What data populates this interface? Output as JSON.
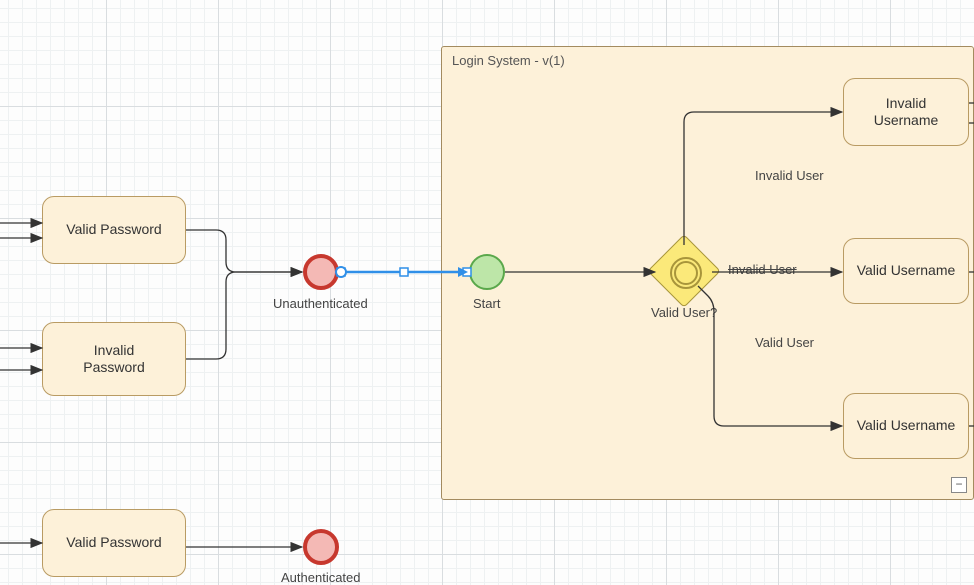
{
  "pool": {
    "title": "Login System - v(1)"
  },
  "tasks": {
    "valid_password_top": "Valid Password",
    "invalid_password": "Invalid\nPassword",
    "valid_password_bottom": "Valid Password",
    "invalid_username": "Invalid\nUsername",
    "valid_username_mid": "Valid Username",
    "valid_username_bot": "Valid Username"
  },
  "events": {
    "unauthenticated": "Unauthenticated",
    "authenticated": "Authenticated",
    "start": "Start"
  },
  "gateway": {
    "valid_user_q": "Valid User?"
  },
  "edge_labels": {
    "invalid_user_top": "Invalid User",
    "invalid_user_mid": "Invalid User",
    "valid_user": "Valid User"
  },
  "collapse_glyph": "−"
}
